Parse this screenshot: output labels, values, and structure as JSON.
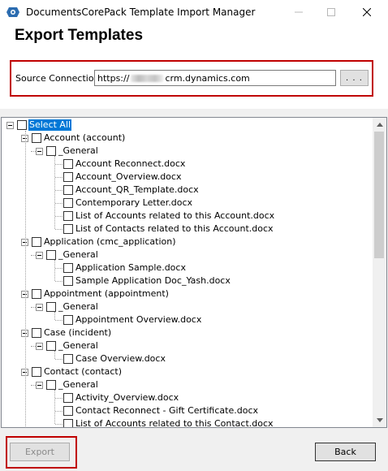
{
  "window": {
    "title": "DocumentsCorePack Template Import Manager"
  },
  "header": {
    "title": "Export Templates"
  },
  "connection": {
    "label": "Source Connection:",
    "url_prefix": "https://",
    "url_suffix": "crm.dynamics.com",
    "browse_label": ". . ."
  },
  "tree": {
    "select_all": "Select All",
    "entities": [
      {
        "label": "Account (account)",
        "folder": "_General",
        "files": [
          "Account Reconnect.docx",
          "Account_Overview.docx",
          "Account_QR_Template.docx",
          "Contemporary Letter.docx",
          "List of Accounts related to this Account.docx",
          "List of Contacts related to this Account.docx"
        ]
      },
      {
        "label": "Application (cmc_application)",
        "folder": "_General",
        "files": [
          "Application Sample.docx",
          "Sample Application Doc_Yash.docx"
        ]
      },
      {
        "label": "Appointment (appointment)",
        "folder": "_General",
        "files": [
          "Appointment Overview.docx"
        ]
      },
      {
        "label": "Case (incident)",
        "folder": "_General",
        "files": [
          "Case Overview.docx"
        ]
      },
      {
        "label": "Contact (contact)",
        "folder": "_General",
        "files": [
          "Activity_Overview.docx",
          "Contact Reconnect - Gift Certificate.docx",
          "List of Accounts related to this Contact.docx"
        ]
      }
    ]
  },
  "footer": {
    "export_label": "Export",
    "back_label": "Back"
  },
  "colors": {
    "highlight": "#c00000",
    "selection": "#0078d7"
  },
  "scroll": {
    "thumb_fraction": 0.45
  }
}
